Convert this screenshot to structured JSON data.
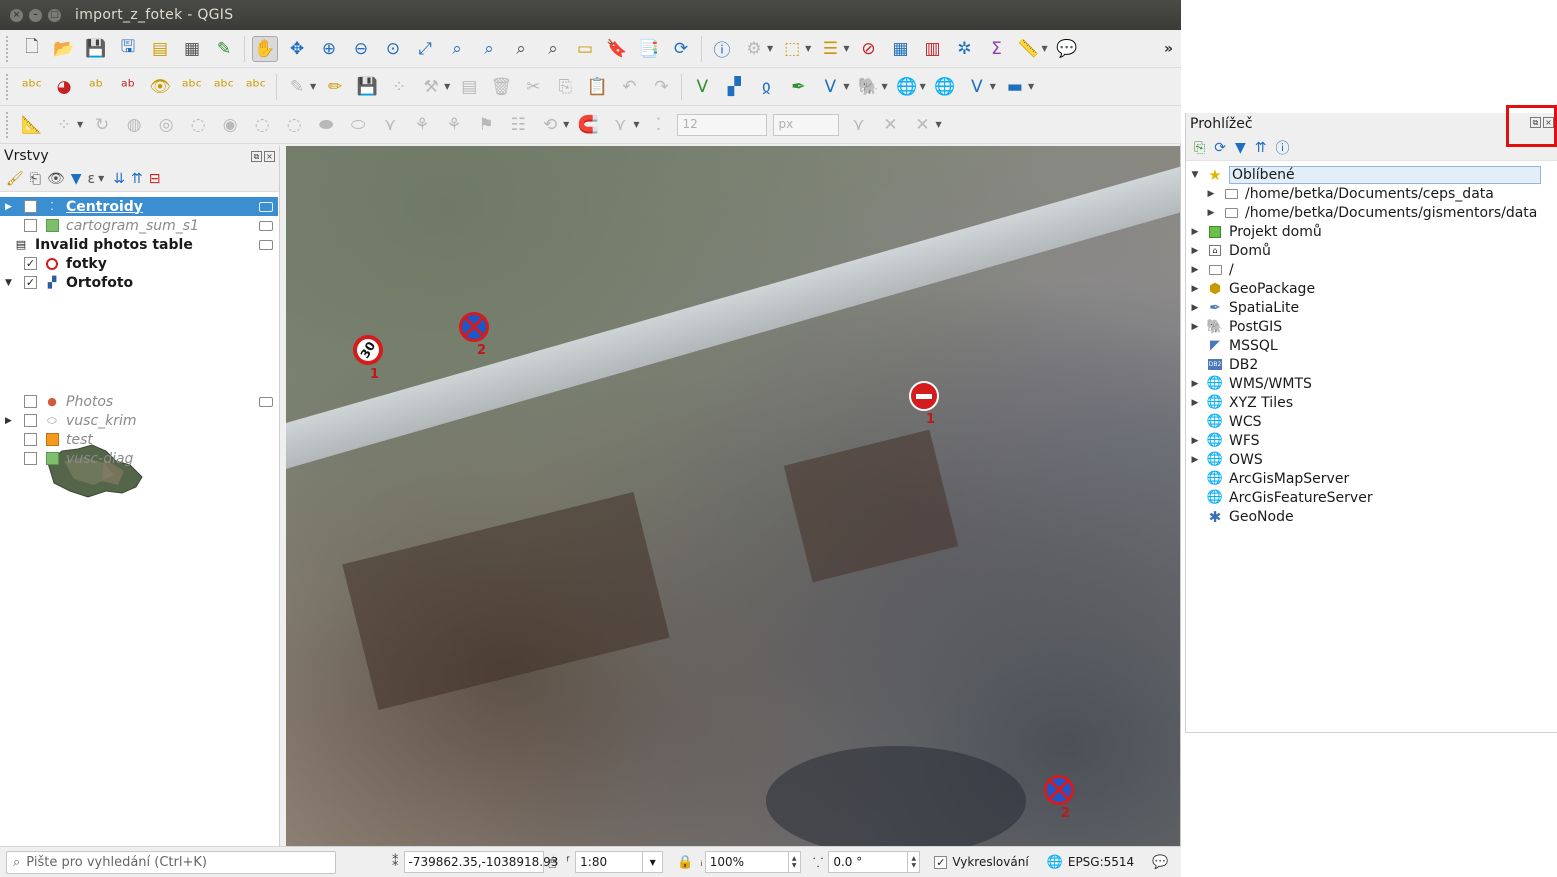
{
  "window": {
    "title": "import_z_fotek - QGIS"
  },
  "layers_panel": {
    "title": "Vrstvy",
    "layers": [
      {
        "name": "Centroidy",
        "checked": false,
        "selected": true,
        "style": "italic",
        "expandable": true
      },
      {
        "name": "cartogram_sum_s1",
        "checked": false,
        "selected": false,
        "style": "italic",
        "expandable": false
      },
      {
        "name": "Invalid photos table",
        "checked": false,
        "selected": false,
        "style": "bold",
        "expandable": false
      },
      {
        "name": "fotky",
        "checked": true,
        "selected": false,
        "style": "bold",
        "expandable": false
      },
      {
        "name": "Ortofoto",
        "checked": true,
        "selected": false,
        "style": "bold",
        "expandable": true
      },
      {
        "name": "Photos",
        "checked": false,
        "selected": false,
        "style": "italic",
        "expandable": false
      },
      {
        "name": "vusc_krim",
        "checked": false,
        "selected": false,
        "style": "italic",
        "expandable": true
      },
      {
        "name": "test",
        "checked": false,
        "selected": false,
        "style": "italic",
        "expandable": false
      },
      {
        "name": "vusc-diag",
        "checked": false,
        "selected": false,
        "style": "italic",
        "expandable": false
      }
    ]
  },
  "map": {
    "markers": [
      {
        "sign": "speed-limit",
        "text": "30",
        "label": "1"
      },
      {
        "sign": "no-parking",
        "label": "2"
      },
      {
        "sign": "no-entry",
        "label": "1"
      },
      {
        "sign": "no-parking",
        "label": "2"
      }
    ]
  },
  "toolbar": {
    "snap_size": "12",
    "snap_unit": "px"
  },
  "browser_panel": {
    "title": "Prohlížeč",
    "items": [
      {
        "label": "Oblíbené",
        "level": 0,
        "expanded": true,
        "icon": "star-icon"
      },
      {
        "label": "/home/betka/Documents/ceps_data",
        "level": 1,
        "expanded": false,
        "icon": "folder-icon"
      },
      {
        "label": "/home/betka/Documents/gismentors/data",
        "level": 1,
        "expanded": false,
        "icon": "folder-icon"
      },
      {
        "label": "Projekt domů",
        "level": 0,
        "expanded": false,
        "icon": "project-icon"
      },
      {
        "label": "Domů",
        "level": 0,
        "expanded": false,
        "icon": "home-folder-icon"
      },
      {
        "label": "/",
        "level": 0,
        "expanded": false,
        "icon": "folder-icon"
      },
      {
        "label": "GeoPackage",
        "level": 0,
        "expanded": false,
        "icon": "geopackage-icon"
      },
      {
        "label": "SpatiaLite",
        "level": 0,
        "expanded": false,
        "icon": "spatialite-icon"
      },
      {
        "label": "PostGIS",
        "level": 0,
        "expanded": false,
        "icon": "postgis-icon"
      },
      {
        "label": "MSSQL",
        "level": 0,
        "expanded": false,
        "icon": "mssql-icon"
      },
      {
        "label": "DB2",
        "level": 0,
        "expanded": false,
        "icon": "db2-icon"
      },
      {
        "label": "WMS/WMTS",
        "level": 0,
        "expanded": false,
        "icon": "globe-icon"
      },
      {
        "label": "XYZ Tiles",
        "level": 0,
        "expanded": false,
        "icon": "globe-icon"
      },
      {
        "label": "WCS",
        "level": 0,
        "expanded": false,
        "icon": "globe-icon"
      },
      {
        "label": "WFS",
        "level": 0,
        "expanded": false,
        "icon": "globe-icon"
      },
      {
        "label": "OWS",
        "level": 0,
        "expanded": false,
        "icon": "globe-icon"
      },
      {
        "label": "ArcGisMapServer",
        "level": 0,
        "expanded": false,
        "icon": "globe-icon"
      },
      {
        "label": "ArcGisFeatureServer",
        "level": 0,
        "expanded": false,
        "icon": "globe-icon"
      },
      {
        "label": "GeoNode",
        "level": 0,
        "expanded": false,
        "icon": "geonode-icon"
      }
    ]
  },
  "status_bar": {
    "search_placeholder": "Pište pro vyhledání (Ctrl+K)",
    "coordinate": "-739862.35,-1038918.93",
    "scale": "1:80",
    "magnifier": "100%",
    "rotation": "0.0 °",
    "render_label": "Vykreslování",
    "render_checked": true,
    "crs": "EPSG:5514"
  },
  "colors": {
    "selection": "#3b8ed0",
    "highlight_box": "#e01010",
    "title_bar": "#3b3b38"
  }
}
